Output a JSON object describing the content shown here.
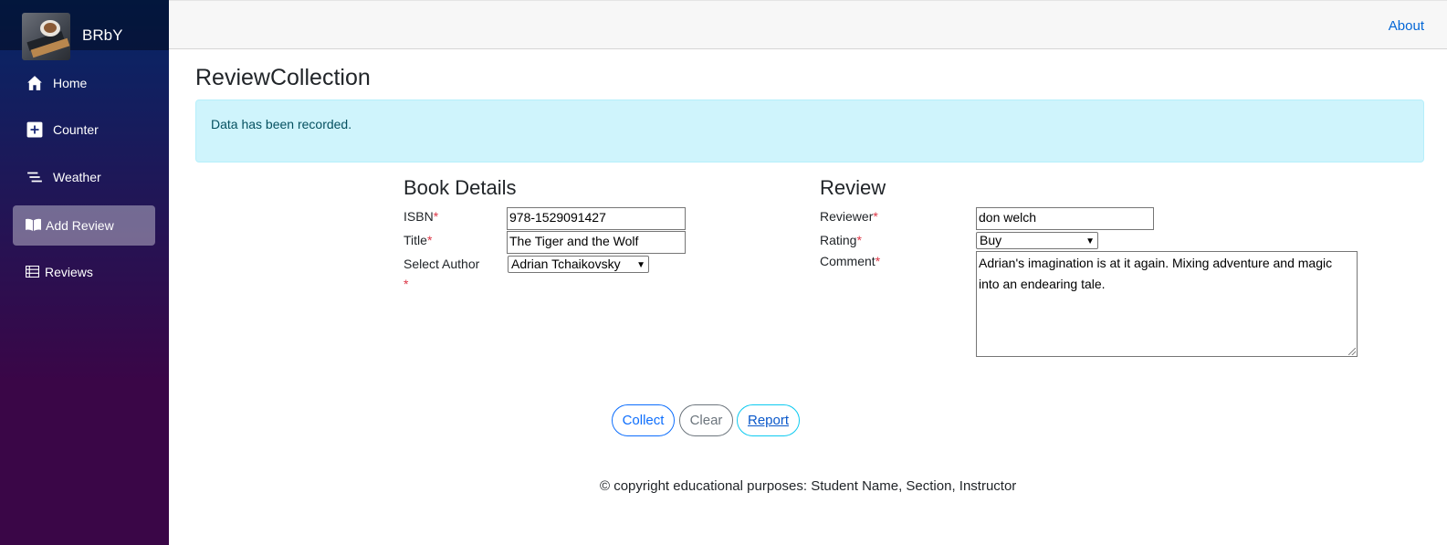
{
  "brand": {
    "name": "BRbY"
  },
  "nav": {
    "home": "Home",
    "counter": "Counter",
    "weather": "Weather",
    "add_review": "Add Review",
    "reviews": "Reviews"
  },
  "topbar": {
    "about": "About"
  },
  "page": {
    "title": "ReviewCollection"
  },
  "alert": {
    "message": "Data has been recorded."
  },
  "book": {
    "heading": "Book Details",
    "isbn_label": "ISBN",
    "isbn_value": "978-1529091427",
    "title_label": "Title",
    "title_value": "The Tiger and the Wolf",
    "author_label": "Select Author",
    "author_value": "Adrian Tchaikovsky",
    "required_mark": "*"
  },
  "review": {
    "heading": "Review",
    "reviewer_label": "Reviewer",
    "reviewer_value": "don welch",
    "rating_label": "Rating",
    "rating_value": "Buy",
    "comment_label": "Comment",
    "comment_value": "Adrian's imagination is at it again. Mixing adventure and magic into an endearing tale."
  },
  "buttons": {
    "collect": "Collect",
    "clear": "Clear",
    "report": "Report"
  },
  "footer": {
    "text": "© copyright educational purposes: Student Name, Section, Instructor"
  },
  "colors": {
    "primary": "#0d6efd",
    "info": "#0dcaf0",
    "alert_bg": "#cff4fc",
    "required": "#dc3545"
  }
}
